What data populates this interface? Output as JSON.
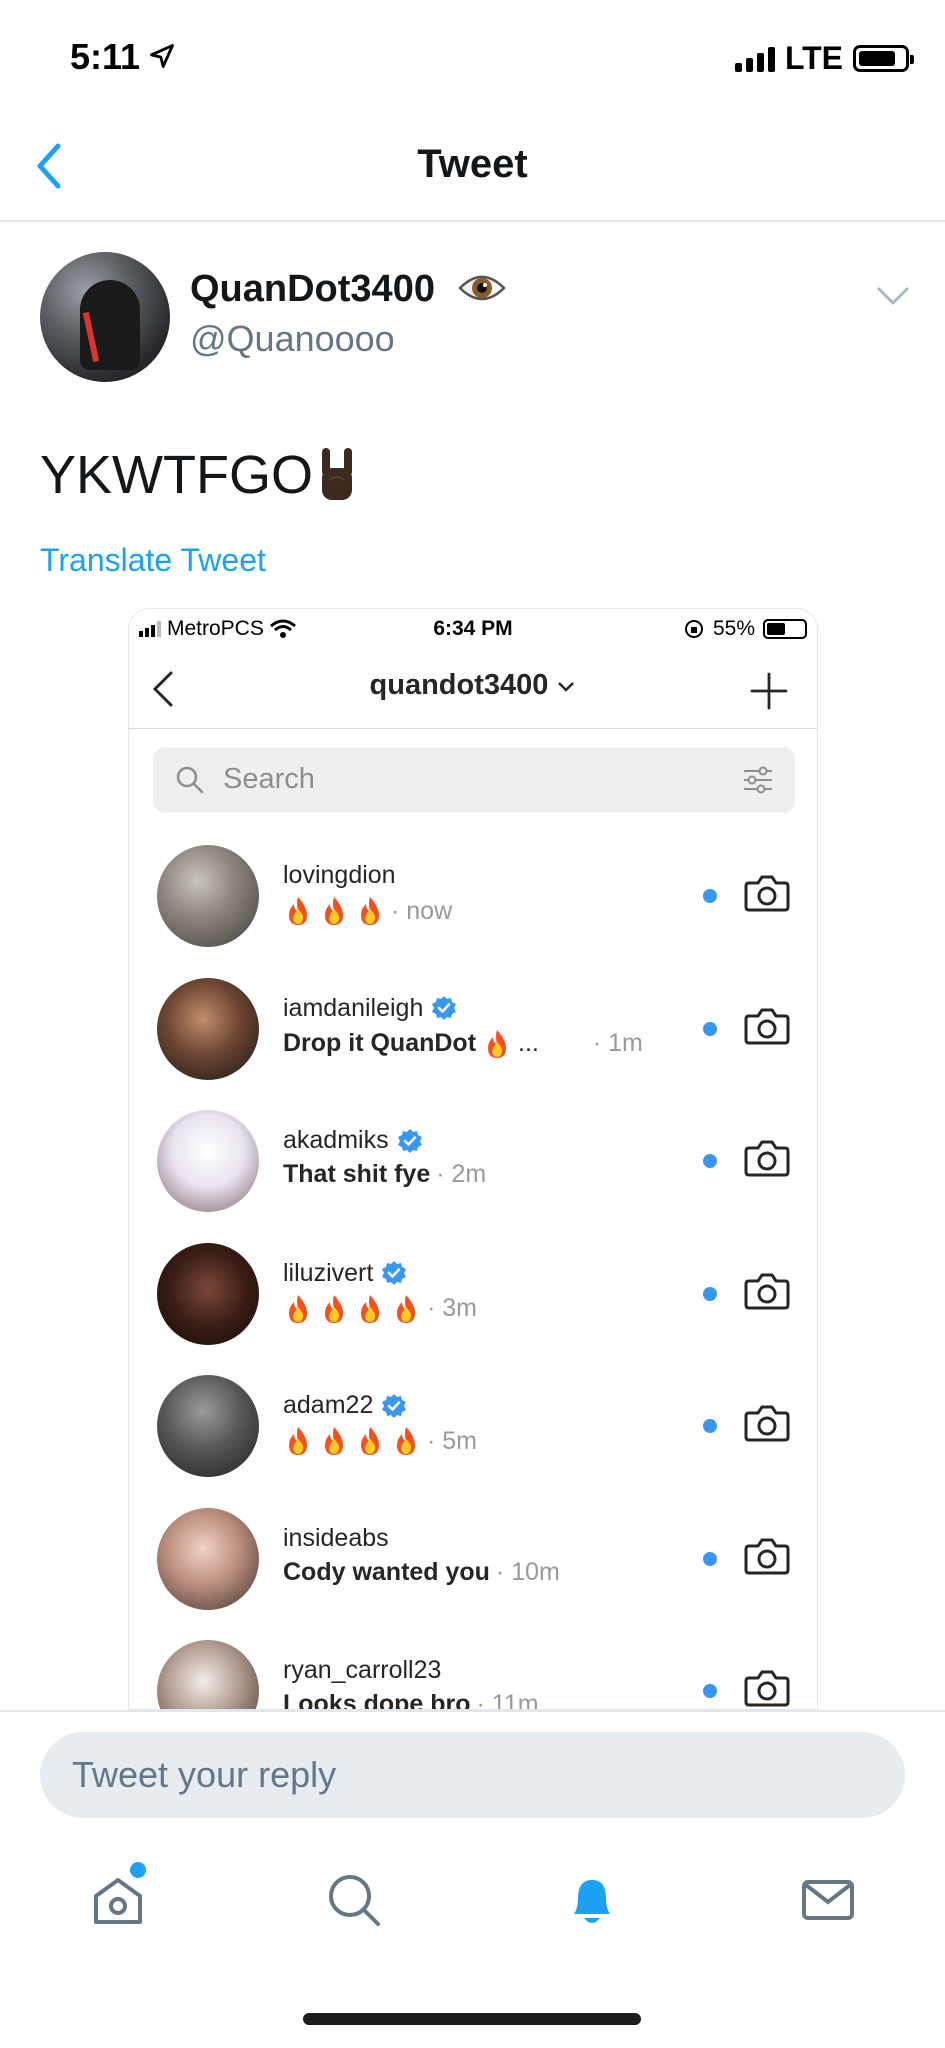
{
  "status_bar": {
    "time": "5:11",
    "network": "LTE"
  },
  "nav": {
    "title": "Tweet"
  },
  "tweet": {
    "author_name": "QuanDot3400",
    "author_handle": "@Quanoooo",
    "text": "YKWTFGO",
    "translate_label": "Translate Tweet"
  },
  "embedded": {
    "carrier": "MetroPCS",
    "time": "6:34 PM",
    "battery": "55%",
    "title": "quandot3400",
    "search_placeholder": "Search",
    "threads": [
      {
        "name": "lovingdion",
        "verified": false,
        "message": "",
        "fires": 3,
        "time": "· now",
        "bold": false
      },
      {
        "name": "iamdanileigh",
        "verified": true,
        "message": "Drop it QuanDot",
        "fires": 1,
        "time": "· 1m",
        "ellipsis": "...",
        "bold": true
      },
      {
        "name": "akadmiks",
        "verified": true,
        "message": "That shit fye",
        "fires": 0,
        "time": "· 2m",
        "bold": true
      },
      {
        "name": "liluzivert",
        "verified": true,
        "message": "",
        "fires": 4,
        "time": "· 3m",
        "bold": false
      },
      {
        "name": "adam22",
        "verified": true,
        "message": "",
        "fires": 4,
        "time": "· 5m",
        "bold": false
      },
      {
        "name": "insideabs",
        "verified": false,
        "message": "Cody wanted you",
        "fires": 0,
        "time": "· 10m",
        "bold": true
      },
      {
        "name": "ryan_carroll23",
        "verified": false,
        "message": "Looks dope bro",
        "fires": 0,
        "time": "· 11m",
        "bold": true
      }
    ]
  },
  "reply": {
    "placeholder": "Tweet your reply"
  },
  "colors": {
    "accent": "#1da1f2",
    "ig_blue": "#3897f0",
    "muted": "#657786"
  }
}
